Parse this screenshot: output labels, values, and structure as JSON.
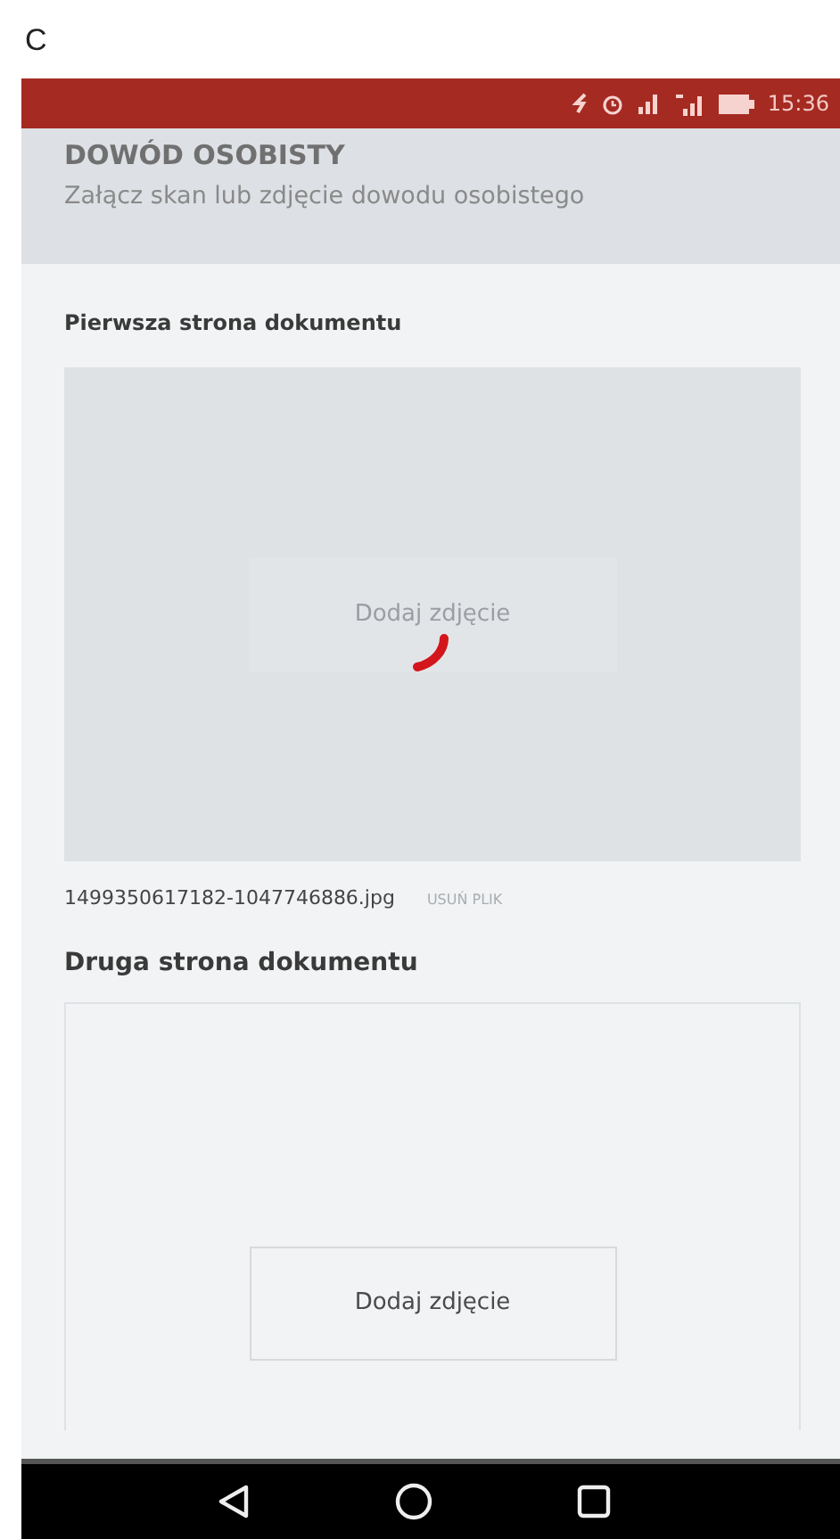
{
  "figure_label": "C",
  "status_bar": {
    "time": "15:36"
  },
  "header": {
    "title": "DOWÓD OSOBISTY",
    "subtitle": "Załącz skan lub zdjęcie dowodu osobistego"
  },
  "sections": [
    {
      "label": "Pierwsza strona dokumentu",
      "loading": true,
      "button": "Dodaj zdjęcie",
      "filename": "1499350617182-1047746886.jpg",
      "remove": "USUŃ PLIK"
    },
    {
      "label": "Druga strona dokumentu",
      "loading": false,
      "button": "Dodaj zdjęcie"
    }
  ]
}
